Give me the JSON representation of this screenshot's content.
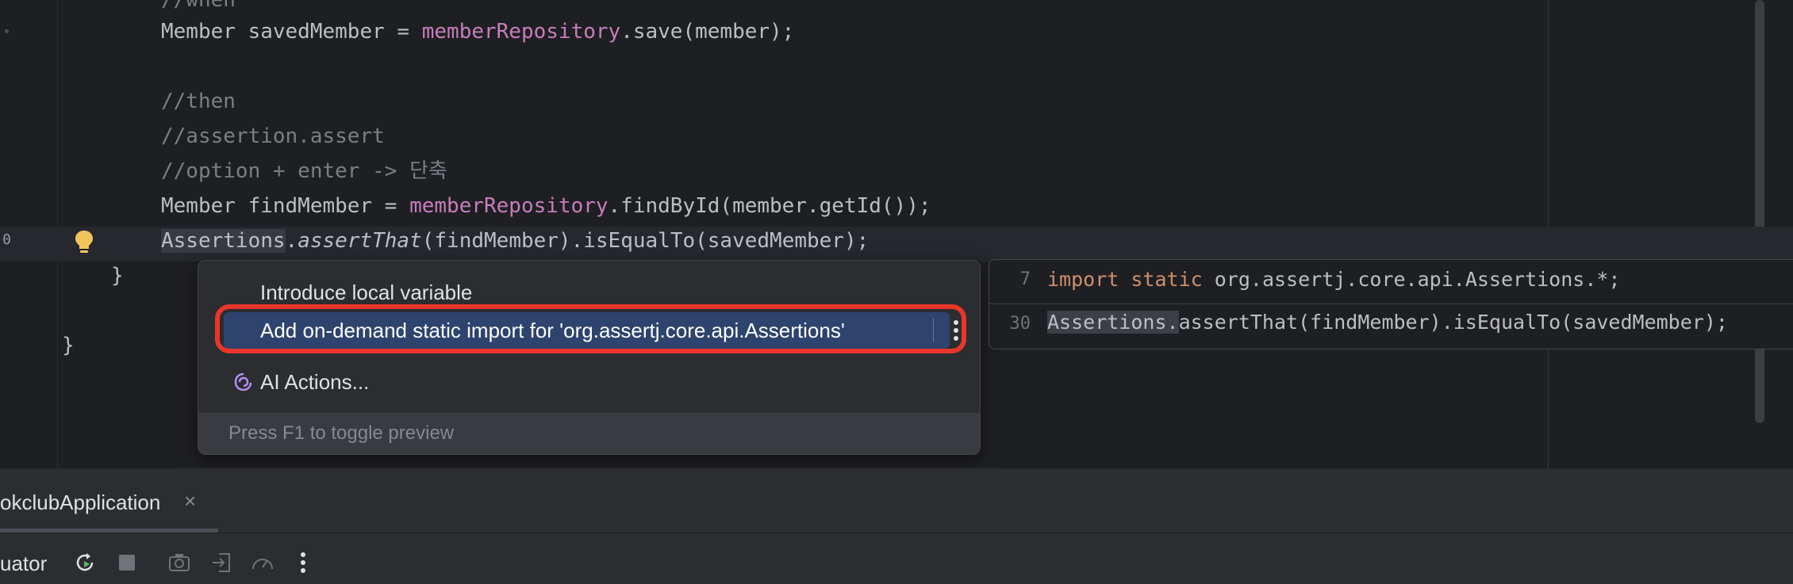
{
  "editor": {
    "lines": {
      "when_comment": "//when",
      "saved_member_a": "Member savedMember = ",
      "saved_member_field": "memberRepository",
      "saved_member_b": ".save(member);",
      "then_comment": "//then",
      "assertion_comment": "//assertion.assert",
      "option_comment": "//option + enter -> 단축",
      "find_member_a": "Member findMember = ",
      "find_member_field": "memberRepository",
      "find_member_b": ".findById(member.getId());",
      "assert_class": "Assertions",
      "assert_dot": ".",
      "assert_method": "assertThat",
      "assert_rest": "(findMember).isEqualTo(savedMember);",
      "method_close": "}",
      "class_close": "}"
    }
  },
  "intention_popup": {
    "items": [
      {
        "label": "Introduce local variable"
      },
      {
        "label": "Add on-demand static import for 'org.assertj.core.api.Assertions'"
      },
      {
        "label": "AI Actions..."
      }
    ],
    "footer": "Press F1 to toggle preview"
  },
  "preview": {
    "line1_number": "7",
    "line1_kw_import": "import",
    "line1_kw_static": "static",
    "line1_rest": " org.assertj.core.api.Assertions.*;",
    "line2_number": "30",
    "line2_class": "Assertions.",
    "line2_rest": "assertThat(findMember).isEqualTo(savedMember);"
  },
  "run_panel": {
    "tab_label": "okclubApplication",
    "tab_close": "×",
    "tool_label": "uator"
  },
  "colors": {
    "accent_selection": "#2e436e",
    "highlight_ring": "#e8362a",
    "keyword": "#cf8e6d",
    "field": "#c77dbb",
    "bulb": "#f2c55c"
  }
}
